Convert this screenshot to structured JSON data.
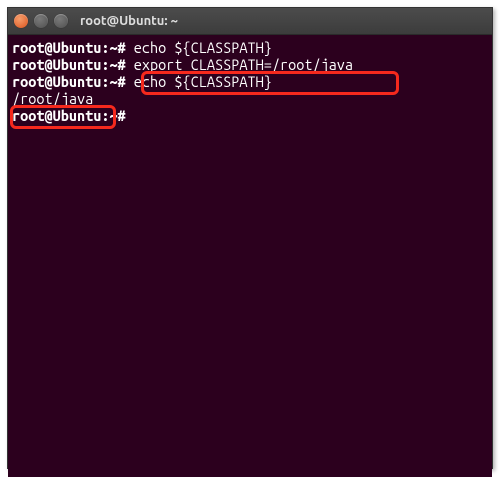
{
  "window": {
    "title": "root@Ubuntu: ~"
  },
  "term": {
    "prompt": "root@Ubuntu:~#",
    "lines": {
      "l1_cmd": " echo ${CLASSPATH}",
      "l2_out": "",
      "l3_cmd": " export CLASSPATH=/root/java",
      "l4_cmd": " echo ${CLASSPATH}",
      "l5_out": "/root/java",
      "l6_cmd": " "
    }
  }
}
